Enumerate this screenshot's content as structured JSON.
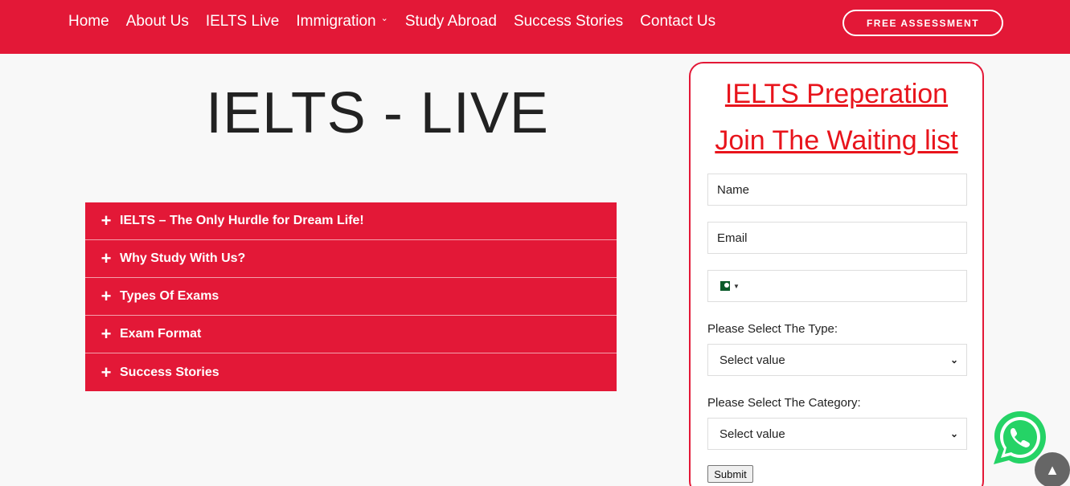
{
  "nav": {
    "items": [
      {
        "label": "Home"
      },
      {
        "label": "About Us"
      },
      {
        "label": "IELTS Live"
      },
      {
        "label": "Immigration",
        "has_dropdown": true
      },
      {
        "label": "Study Abroad"
      },
      {
        "label": "Success Stories"
      },
      {
        "label": "Contact Us"
      }
    ],
    "cta_label": "FREE ASSESSMENT"
  },
  "page": {
    "title": "IELTS - LIVE"
  },
  "accordion": {
    "items": [
      {
        "label": "IELTS – The Only Hurdle for Dream Life!"
      },
      {
        "label": "Why Study With Us?"
      },
      {
        "label": "Types Of Exams"
      },
      {
        "label": "Exam Format"
      },
      {
        "label": "Success Stories"
      }
    ]
  },
  "form": {
    "heading1": "IELTS Preperation",
    "heading2": "Join The Waiting list",
    "name_placeholder": "Name",
    "email_placeholder": "Email",
    "type_label": "Please Select The Type:",
    "type_value": "Select value",
    "category_label": "Please Select The Category:",
    "category_value": "Select value",
    "submit_label": "Submit"
  },
  "colors": {
    "brand_red": "#e31837",
    "whatsapp_green": "#25d366"
  }
}
